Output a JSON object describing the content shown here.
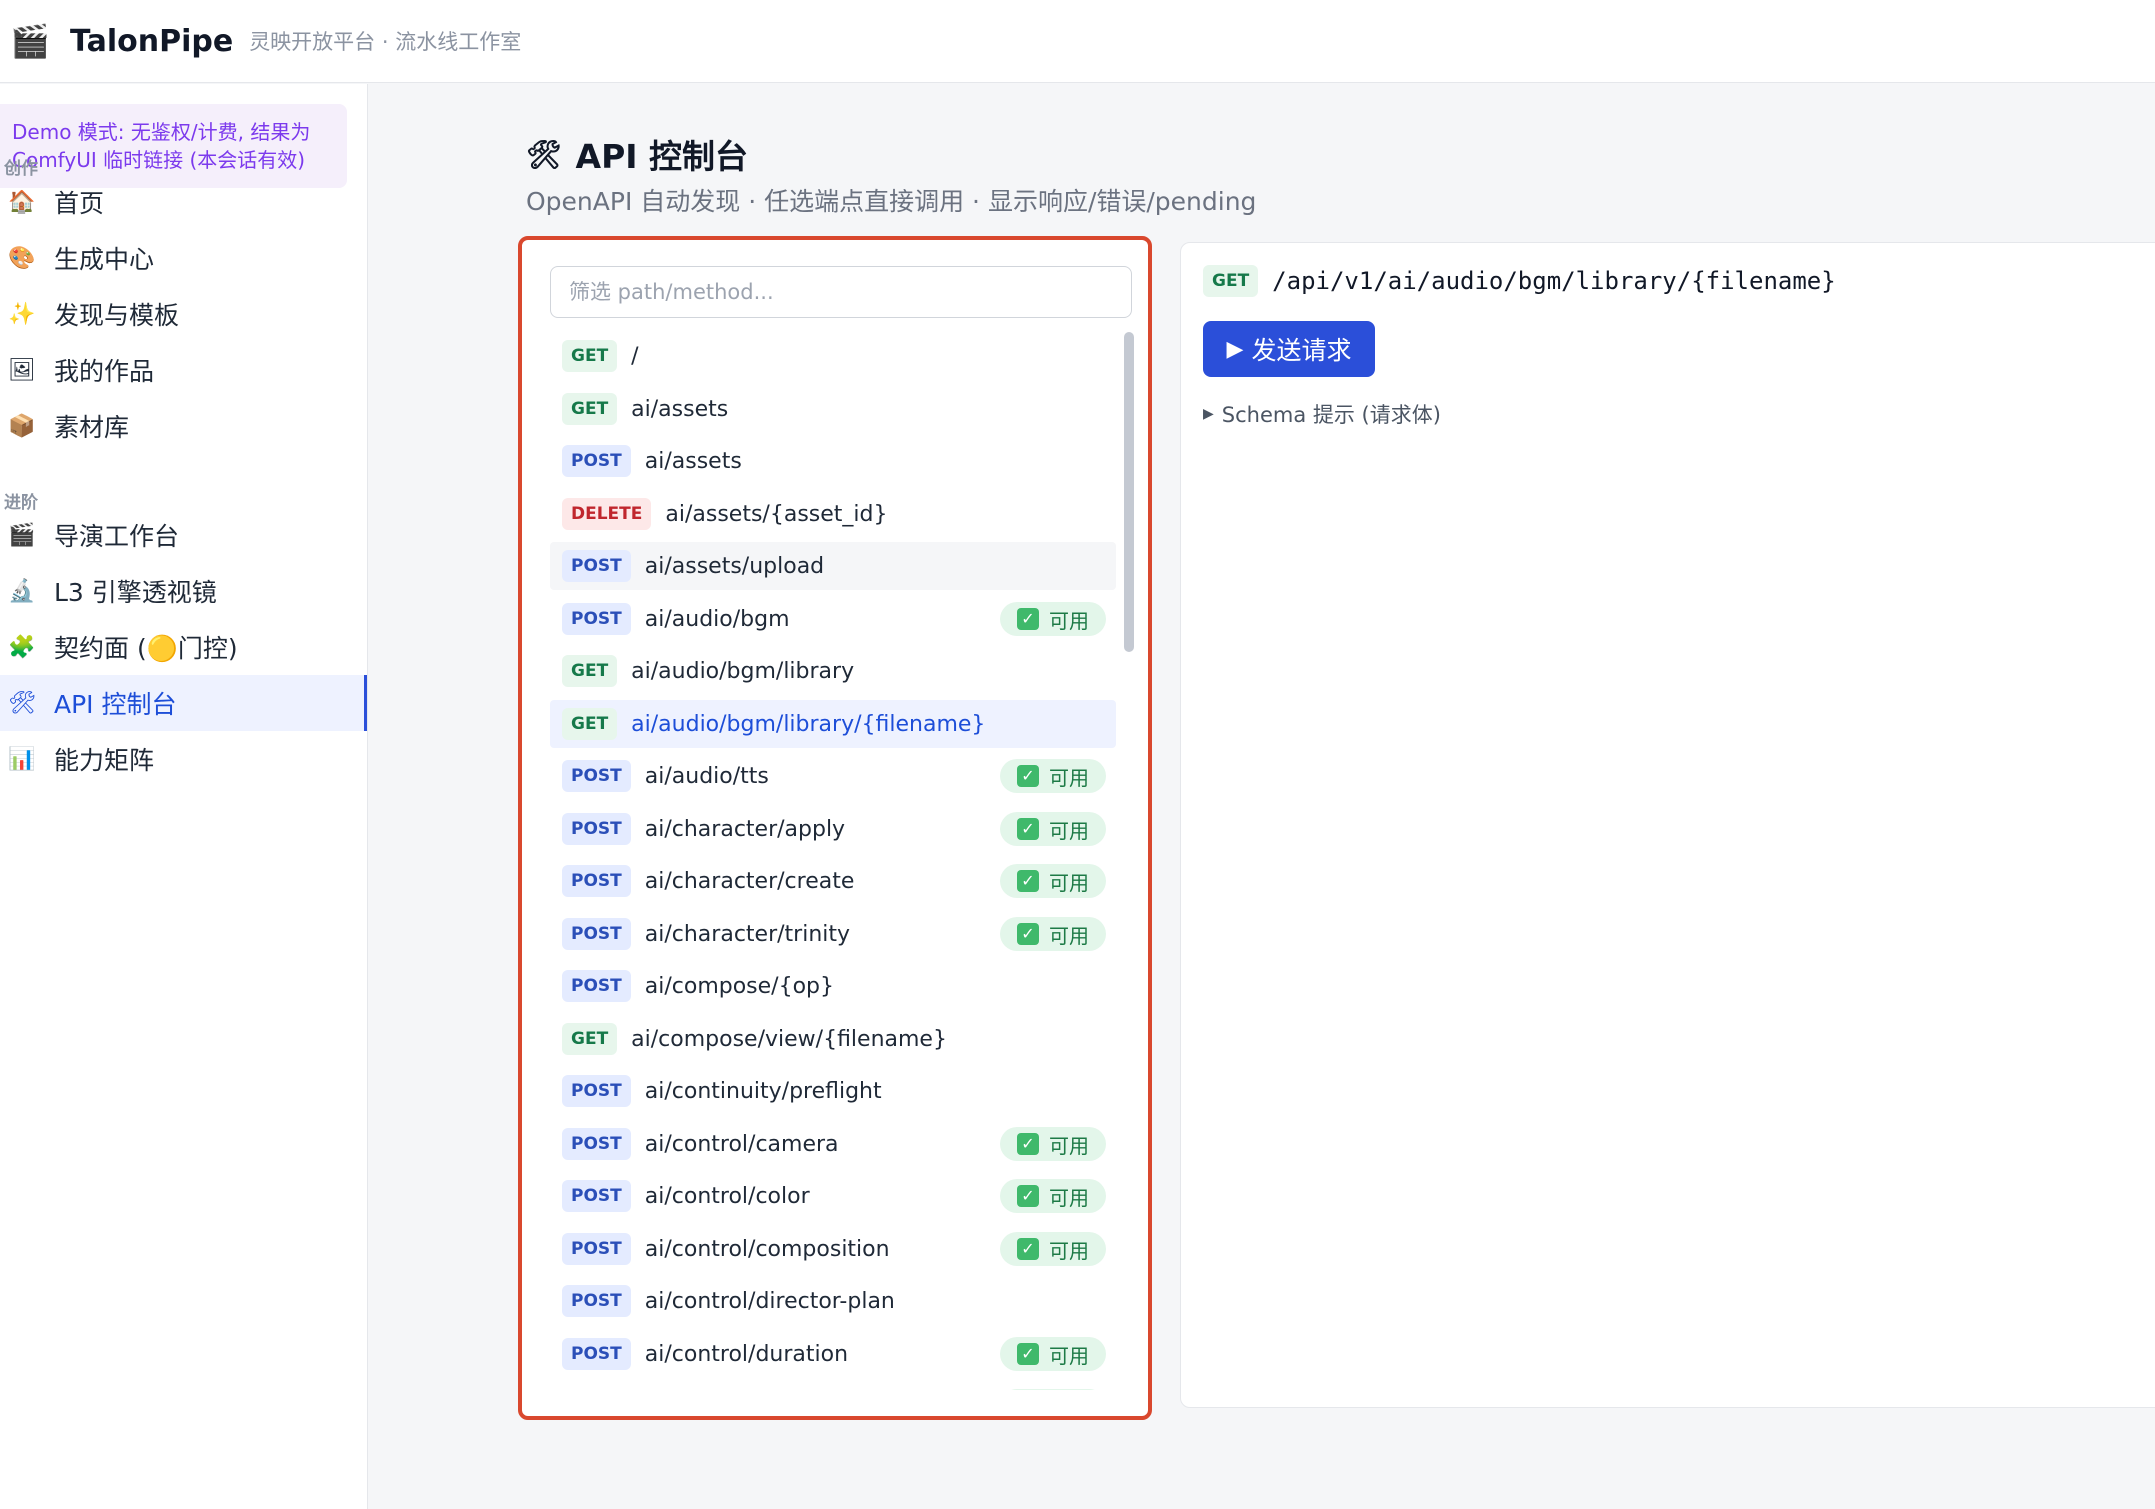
{
  "app": {
    "icon": "clapper-icon",
    "name": "TalonPipe",
    "subtitle": "灵映开放平台 · 流水线工作室"
  },
  "sidebar": {
    "demo_notice": "Demo 模式: 无鉴权/计费, 结果为 ComfyUI 临时链接 (本会话有效)",
    "sections": [
      {
        "label": "创作"
      },
      {
        "label": "进阶"
      }
    ],
    "items": [
      {
        "icon": "🏠",
        "label": "首页"
      },
      {
        "icon": "🎨",
        "label": "生成中心"
      },
      {
        "icon": "✨",
        "label": "发现与模板"
      },
      {
        "icon": "🖼",
        "label": "我的作品"
      },
      {
        "icon": "📦",
        "label": "素材库"
      },
      {
        "icon": "🎬",
        "label": "导演工作台"
      },
      {
        "icon": "🔬",
        "label": "L3 引擎透视镜"
      },
      {
        "icon": "🧩",
        "label": "契约面 (🟡门控)"
      },
      {
        "icon": "🛠",
        "label": "API 控制台",
        "active": true
      },
      {
        "icon": "📊",
        "label": "能力矩阵"
      }
    ]
  },
  "header": {
    "icon": "🛠",
    "title": "API 控制台",
    "subtitle": "OpenAPI 自动发现 · 任选端点直接调用 · 显示响应/错误/pending"
  },
  "filter": {
    "placeholder": "筛选 path/method..."
  },
  "available_label": "可用",
  "endpoints": [
    {
      "method": "GET",
      "path": "/",
      "available": false
    },
    {
      "method": "GET",
      "path": "ai/assets",
      "available": false
    },
    {
      "method": "POST",
      "path": "ai/assets",
      "available": false
    },
    {
      "method": "DELETE",
      "path": "ai/assets/{asset_id}",
      "available": false
    },
    {
      "method": "POST",
      "path": "ai/assets/upload",
      "available": false,
      "hover": true
    },
    {
      "method": "POST",
      "path": "ai/audio/bgm",
      "available": true
    },
    {
      "method": "GET",
      "path": "ai/audio/bgm/library",
      "available": false
    },
    {
      "method": "GET",
      "path": "ai/audio/bgm/library/{filename}",
      "available": false,
      "selected": true
    },
    {
      "method": "POST",
      "path": "ai/audio/tts",
      "available": true
    },
    {
      "method": "POST",
      "path": "ai/character/apply",
      "available": true
    },
    {
      "method": "POST",
      "path": "ai/character/create",
      "available": true
    },
    {
      "method": "POST",
      "path": "ai/character/trinity",
      "available": true
    },
    {
      "method": "POST",
      "path": "ai/compose/{op}",
      "available": false
    },
    {
      "method": "GET",
      "path": "ai/compose/view/{filename}",
      "available": false
    },
    {
      "method": "POST",
      "path": "ai/continuity/preflight",
      "available": false
    },
    {
      "method": "POST",
      "path": "ai/control/camera",
      "available": true
    },
    {
      "method": "POST",
      "path": "ai/control/color",
      "available": true
    },
    {
      "method": "POST",
      "path": "ai/control/composition",
      "available": true
    },
    {
      "method": "POST",
      "path": "ai/control/director-plan",
      "available": false
    },
    {
      "method": "POST",
      "path": "ai/control/duration",
      "available": true
    },
    {
      "method": "POST",
      "path": "",
      "available": true
    }
  ],
  "request": {
    "method": "GET",
    "path": "/api/v1/ai/audio/bgm/library/{filename}",
    "send_label": "发送请求",
    "schema_label": "Schema 提示 (请求体)"
  }
}
